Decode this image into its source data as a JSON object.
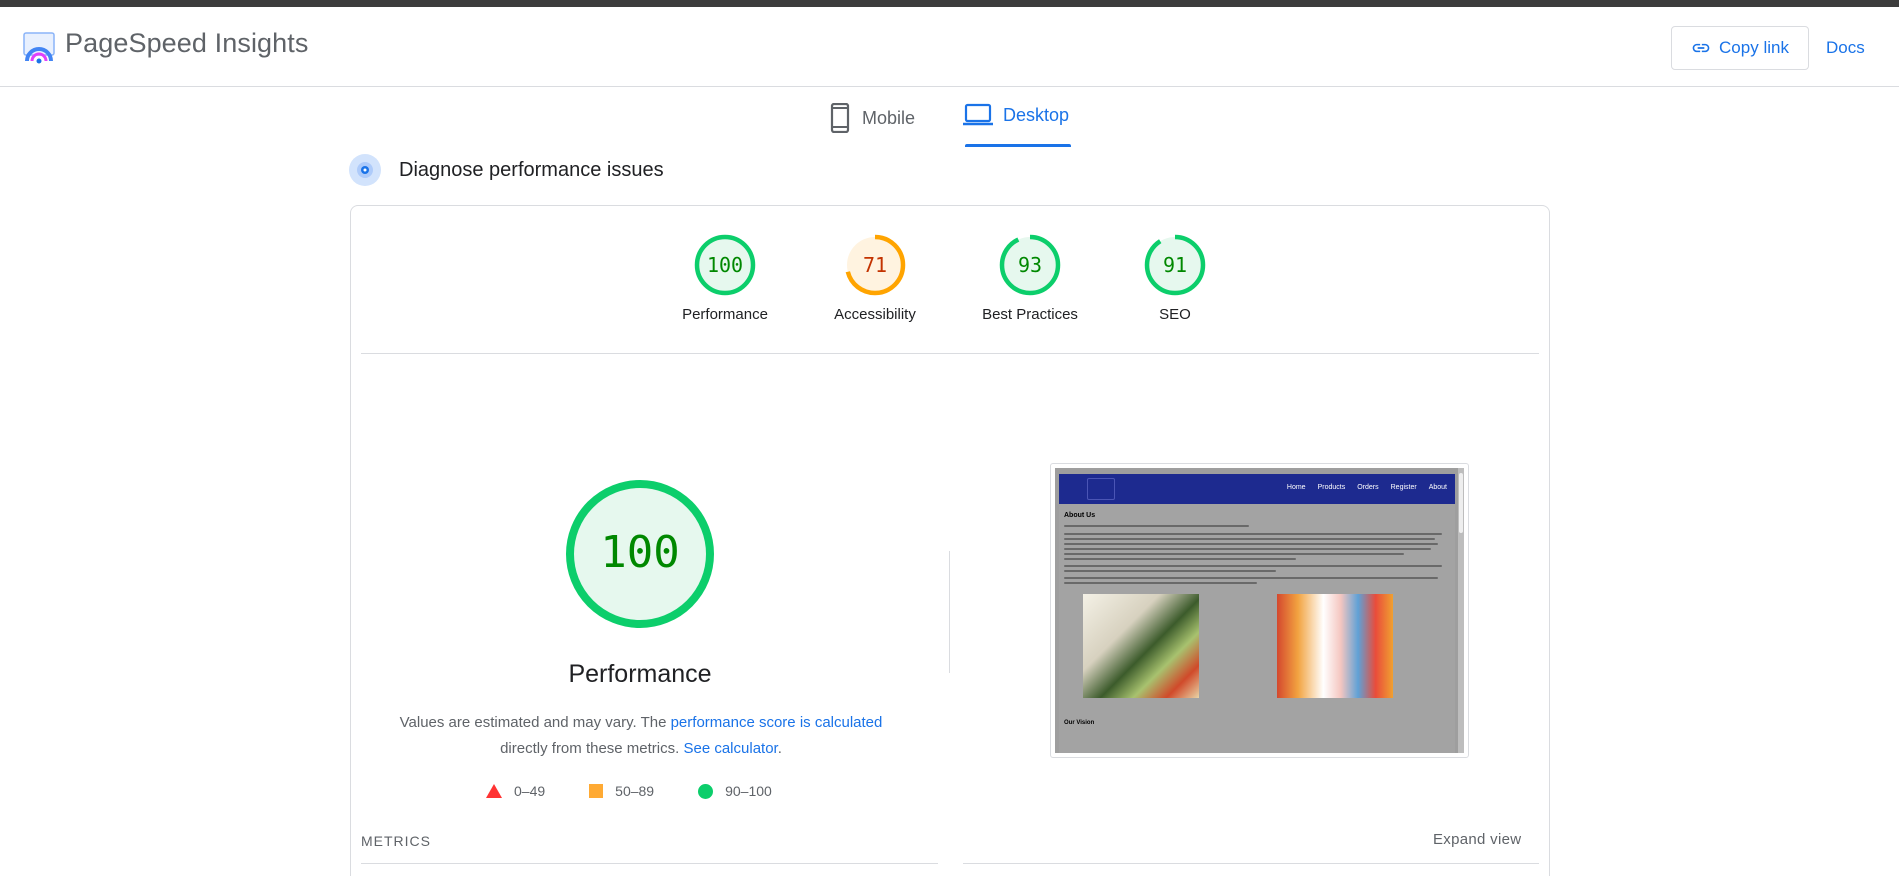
{
  "app": {
    "title": "PageSpeed Insights",
    "copy_link_label": "Copy link",
    "docs_label": "Docs"
  },
  "tabs": [
    {
      "label": "Mobile",
      "active": false,
      "icon": "smartphone-icon"
    },
    {
      "label": "Desktop",
      "active": true,
      "icon": "laptop-icon"
    }
  ],
  "section": {
    "title": "Diagnose performance issues"
  },
  "scores": [
    {
      "label": "Performance",
      "value": 100,
      "status": "pass"
    },
    {
      "label": "Accessibility",
      "value": 71,
      "status": "average"
    },
    {
      "label": "Best Practices",
      "value": 93,
      "status": "pass"
    },
    {
      "label": "SEO",
      "value": 91,
      "status": "pass"
    }
  ],
  "performance": {
    "score": "100",
    "title": "Performance",
    "desc_prefix": "Values are estimated and may vary. The ",
    "desc_link1": "performance score is calculated",
    "desc_mid": " directly from these metrics. ",
    "desc_link2": "See calculator",
    "desc_suffix": "."
  },
  "legend": [
    {
      "shape": "triangle",
      "range": "0–49",
      "color": "#ff3333"
    },
    {
      "shape": "square",
      "range": "50–89",
      "color": "#ffaa33"
    },
    {
      "shape": "circle",
      "range": "90–100",
      "color": "#0cce6b"
    }
  ],
  "screenshot": {
    "nav_links": [
      "Home",
      "Products",
      "Orders",
      "Register",
      "About"
    ],
    "heading": "About Us",
    "subheading": "Our Vision"
  },
  "metrics_section": {
    "label": "METRICS",
    "expand_label": "Expand view"
  },
  "colors": {
    "pass": "#0cce6b",
    "pass_text": "#008800",
    "pass_bg": "#e6f8ee",
    "average": "#ffa400",
    "average_text": "#c33300",
    "average_bg": "#fff3e0",
    "accent": "#1a73e8"
  }
}
